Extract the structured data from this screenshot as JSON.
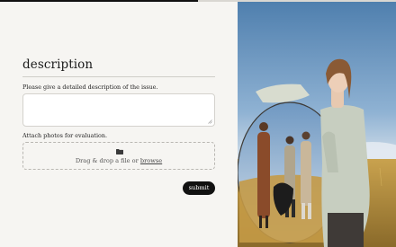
{
  "progress": {
    "fraction": 0.5
  },
  "form": {
    "title": "description",
    "description_label": "Please give a detailed description of the issue.",
    "description_value": "",
    "photos_label": "Attach photos for evaluation.",
    "drop_text": "Drag & drop a file or ",
    "browse_label": "browse",
    "submit_label": "submit"
  },
  "icons": {
    "upload": "folder-icon",
    "resize": "resize-grip-icon"
  },
  "colors": {
    "accent": "#111111",
    "background": "#f6f5f2",
    "field": "#ffffff"
  },
  "image": {
    "subject": "fashion-photo-models-in-wheat-field-with-mirror"
  }
}
